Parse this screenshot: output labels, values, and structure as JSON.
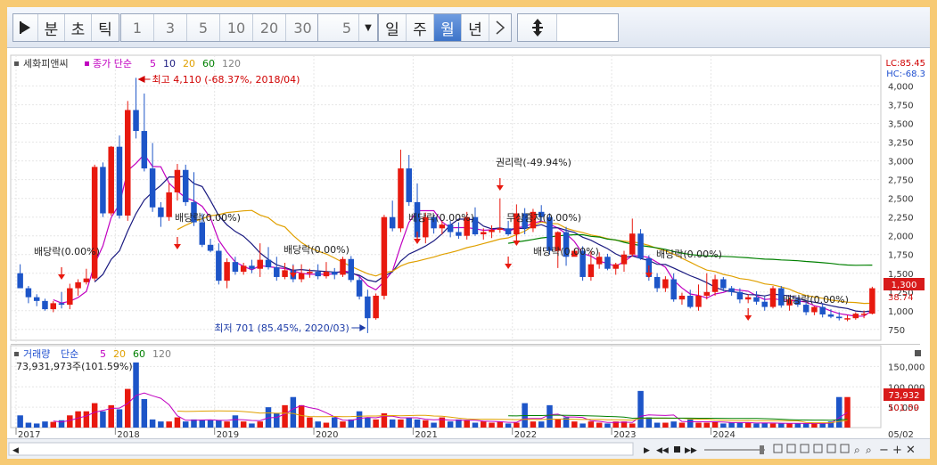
{
  "toolbar": {
    "play_icon": "play-triangle-icon",
    "buttons_unit": [
      "분",
      "초",
      "틱"
    ],
    "buttons_num": [
      "1",
      "3",
      "5",
      "10",
      "20",
      "30"
    ],
    "count_value": "5",
    "dropdown_icon": "dropdown-caret-icon",
    "periods": [
      "일",
      "주",
      "월",
      "년"
    ],
    "active_period": "월",
    "next_icon": "chevron-right-icon",
    "expand_icon": "vertical-expand-icon"
  },
  "price_panel": {
    "stock_name": "세화피앤씨",
    "legend_prefix": "종가 단순",
    "ma_labels": [
      "5",
      "10",
      "20",
      "60",
      "120"
    ],
    "ma_colors": [
      "#c000c0",
      "#1a1a80",
      "#e0a000",
      "#008000",
      "#808080"
    ],
    "top_right_lc": "LC:85.45",
    "top_right_hc": "HC:-68.3",
    "price_badge": "1,300",
    "pct_badge": "38.74",
    "y_ticks": [
      "4,000",
      "3,750",
      "3,500",
      "3,250",
      "3,000",
      "2,750",
      "2,500",
      "2,250",
      "2,000",
      "1,750",
      "1,500",
      "1,250",
      "1,000",
      "750"
    ],
    "high_note": "최고 4,110 (-68.37%, 2018/04)",
    "low_note": "최저 701 (85.45%, 2020/03)",
    "annotations": [
      "배당락(0.00%)",
      "배당락(0.00%)",
      "배당락(0.00%)",
      "배당락(0.00%)",
      "권리락(-49.94%)",
      "무상증자(0.00%)",
      "배당락(0.00%)",
      "배당락(0.00%)",
      "배당락(0.00%)"
    ]
  },
  "volume_panel": {
    "title": "거래량",
    "legend_prefix": "단순",
    "ma_labels": [
      "5",
      "20",
      "60",
      "120"
    ],
    "ma_colors": [
      "#c000c0",
      "#e0a000",
      "#008000",
      "#808080"
    ],
    "current_volume": "73,931,973주(101.59%)",
    "y_ticks": [
      "150,000",
      "100,000",
      "50,000"
    ],
    "badge_volume": "73,932",
    "badge_pct": "101.59"
  },
  "x_axis": {
    "labels": [
      "2017",
      "2018",
      "2019",
      "2020",
      "2021",
      "2022",
      "2023",
      "2024"
    ],
    "end_label": "05/02"
  },
  "bottom_bar": {
    "icons": [
      "scroll-left-icon",
      "play-icon",
      "rewind-icon",
      "stop-icon",
      "fast-forward-icon",
      "zoom-slider-icon",
      "chart-icon",
      "zoom-minus-icon",
      "zoom-plus-icon"
    ]
  },
  "chart_data": {
    "type": "candlestick",
    "period": "monthly",
    "x_start": "2017-01",
    "ylim": [
      700,
      4150
    ],
    "candles": [
      [
        1500,
        1620,
        1380,
        1300
      ],
      [
        1300,
        1330,
        1100,
        1180
      ],
      [
        1180,
        1220,
        1060,
        1130
      ],
      [
        1130,
        1160,
        1000,
        1020
      ],
      [
        1020,
        1130,
        980,
        1100
      ],
      [
        1100,
        1250,
        1030,
        1080
      ],
      [
        1080,
        1360,
        1020,
        1300
      ],
      [
        1300,
        1420,
        1200,
        1380
      ],
      [
        1380,
        1560,
        1350,
        1430
      ],
      [
        1430,
        2950,
        1400,
        2920
      ],
      [
        2920,
        2980,
        2250,
        2300
      ],
      [
        2300,
        3200,
        2270,
        3190
      ],
      [
        3190,
        3340,
        2230,
        2270
      ],
      [
        2270,
        3800,
        2200,
        3680
      ],
      [
        3680,
        4110,
        3300,
        3400
      ],
      [
        3400,
        3900,
        2860,
        2900
      ],
      [
        2900,
        3240,
        2320,
        2380
      ],
      [
        2380,
        2450,
        2120,
        2250
      ],
      [
        2250,
        2700,
        2200,
        2580
      ],
      [
        2580,
        2960,
        2470,
        2880
      ],
      [
        2880,
        2950,
        2400,
        2450
      ],
      [
        2450,
        2850,
        2130,
        2180
      ],
      [
        2180,
        2300,
        1850,
        1880
      ],
      [
        1880,
        1960,
        1780,
        1800
      ],
      [
        1800,
        1900,
        1350,
        1400
      ],
      [
        1400,
        1700,
        1300,
        1650
      ],
      [
        1650,
        1720,
        1480,
        1520
      ],
      [
        1520,
        1640,
        1480,
        1600
      ],
      [
        1600,
        1680,
        1500,
        1560
      ],
      [
        1560,
        1900,
        1450,
        1680
      ],
      [
        1680,
        1850,
        1550,
        1580
      ],
      [
        1580,
        1720,
        1400,
        1450
      ],
      [
        1450,
        1640,
        1420,
        1540
      ],
      [
        1540,
        1620,
        1380,
        1420
      ],
      [
        1420,
        1620,
        1380,
        1500
      ],
      [
        1500,
        1560,
        1440,
        1520
      ],
      [
        1520,
        1620,
        1420,
        1460
      ],
      [
        1460,
        1650,
        1430,
        1520
      ],
      [
        1520,
        1570,
        1420,
        1480
      ],
      [
        1480,
        1720,
        1450,
        1690
      ],
      [
        1690,
        1730,
        1380,
        1410
      ],
      [
        1410,
        1460,
        1150,
        1190
      ],
      [
        1190,
        1280,
        701,
        900
      ],
      [
        900,
        1230,
        880,
        1200
      ],
      [
        1200,
        2280,
        1150,
        2250
      ],
      [
        2250,
        2470,
        2060,
        2100
      ],
      [
        2100,
        3150,
        2050,
        2900
      ],
      [
        2900,
        3080,
        2400,
        2450
      ],
      [
        2450,
        2700,
        1950,
        1980
      ],
      [
        1980,
        2310,
        1900,
        2250
      ],
      [
        2250,
        2280,
        2030,
        2100
      ],
      [
        2100,
        2200,
        2020,
        2150
      ],
      [
        2150,
        2200,
        1980,
        2050
      ],
      [
        2050,
        2180,
        1960,
        2000
      ],
      [
        2000,
        2320,
        1950,
        2250
      ],
      [
        2250,
        2380,
        2000,
        2020
      ],
      [
        2020,
        2100,
        1950,
        2050
      ],
      [
        2050,
        2140,
        1970,
        2080
      ],
      [
        2080,
        2500,
        2040,
        2100
      ],
      [
        2100,
        2200,
        2000,
        2020
      ],
      [
        2020,
        2420,
        1980,
        2300
      ],
      [
        2300,
        2370,
        2020,
        2100
      ],
      [
        2100,
        2360,
        2050,
        2320
      ],
      [
        2320,
        2410,
        2200,
        2250
      ],
      [
        2250,
        2300,
        1750,
        1800
      ],
      [
        1800,
        2060,
        1570,
        2050
      ],
      [
        2050,
        2120,
        1600,
        1720
      ],
      [
        1720,
        1830,
        1750,
        1800
      ],
      [
        1800,
        1860,
        1400,
        1450
      ],
      [
        1450,
        1800,
        1400,
        1620
      ],
      [
        1620,
        1780,
        1560,
        1720
      ],
      [
        1720,
        1760,
        1540,
        1560
      ],
      [
        1560,
        1640,
        1480,
        1620
      ],
      [
        1620,
        1800,
        1520,
        1750
      ],
      [
        1750,
        2230,
        1720,
        2030
      ],
      [
        2030,
        2090,
        1680,
        1700
      ],
      [
        1700,
        1740,
        1400,
        1450
      ],
      [
        1450,
        1500,
        1250,
        1300
      ],
      [
        1300,
        1460,
        1250,
        1420
      ],
      [
        1420,
        1500,
        1120,
        1150
      ],
      [
        1150,
        1240,
        1080,
        1200
      ],
      [
        1200,
        1280,
        1030,
        1050
      ],
      [
        1050,
        1350,
        1000,
        1200
      ],
      [
        1200,
        1500,
        1150,
        1250
      ],
      [
        1250,
        1480,
        1200,
        1420
      ],
      [
        1420,
        1450,
        1260,
        1300
      ],
      [
        1300,
        1330,
        1200,
        1250
      ],
      [
        1250,
        1300,
        1100,
        1150
      ],
      [
        1150,
        1220,
        1100,
        1180
      ],
      [
        1180,
        1260,
        1080,
        1120
      ],
      [
        1120,
        1190,
        1000,
        1050
      ],
      [
        1050,
        1330,
        1030,
        1300
      ],
      [
        1300,
        1330,
        1040,
        1070
      ],
      [
        1070,
        1180,
        1000,
        1150
      ],
      [
        1150,
        1180,
        1050,
        1080
      ],
      [
        1080,
        1130,
        940,
        980
      ],
      [
        980,
        1060,
        940,
        1050
      ],
      [
        1050,
        1090,
        910,
        950
      ],
      [
        950,
        1020,
        900,
        920
      ],
      [
        920,
        980,
        870,
        900
      ],
      [
        900,
        940,
        860,
        900
      ],
      [
        900,
        980,
        880,
        960
      ],
      [
        960,
        1000,
        900,
        960
      ],
      [
        960,
        1320,
        950,
        1300
      ]
    ],
    "volumes": [
      30,
      12,
      10,
      15,
      14,
      18,
      30,
      40,
      40,
      60,
      40,
      55,
      45,
      95,
      160,
      70,
      20,
      15,
      15,
      25,
      15,
      20,
      18,
      18,
      18,
      15,
      30,
      15,
      10,
      15,
      50,
      35,
      55,
      75,
      55,
      25,
      15,
      12,
      25,
      15,
      20,
      40,
      25,
      20,
      35,
      20,
      20,
      25,
      20,
      18,
      12,
      25,
      15,
      20,
      18,
      12,
      15,
      12,
      15,
      10,
      12,
      60,
      15,
      15,
      55,
      20,
      25,
      15,
      10,
      15,
      12,
      10,
      15,
      15,
      10,
      90,
      25,
      12,
      12,
      15,
      12,
      20,
      12,
      12,
      15,
      10,
      12,
      12,
      12,
      10,
      12,
      10,
      10,
      10,
      10,
      10,
      10,
      10,
      15,
      75,
      75
    ],
    "volume_ylim": [
      0,
      175000
    ],
    "ma_series": [
      "5",
      "10",
      "20",
      "60",
      "120"
    ]
  }
}
